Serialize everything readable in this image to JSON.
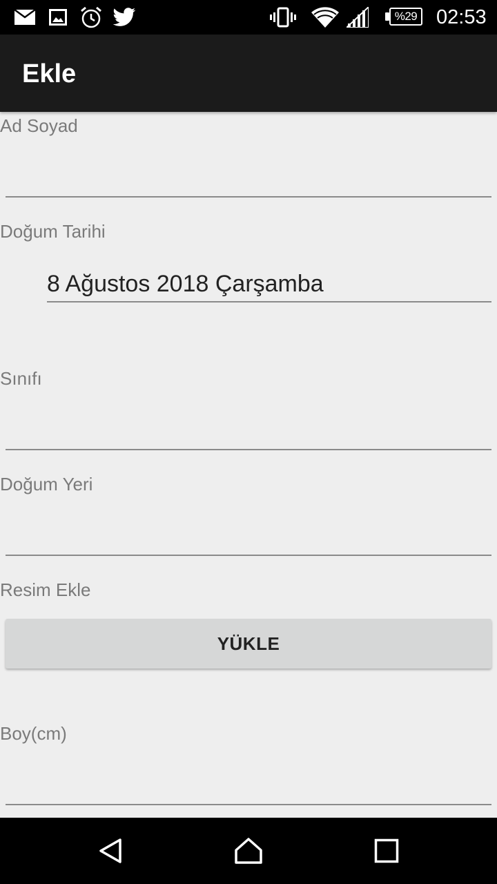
{
  "status_bar": {
    "icons": [
      "mail-icon",
      "image-icon",
      "alarm-icon",
      "twitter-icon",
      "vibrate-icon",
      "wifi-icon",
      "signal-icon",
      "battery-icon"
    ],
    "battery": "%29",
    "time": "02:53"
  },
  "app_bar": {
    "title": "Ekle"
  },
  "form": {
    "name_label": "Ad Soyad",
    "name_value": "",
    "birth_date_label": "Doğum Tarihi",
    "birth_date_value": "8 Ağustos 2018 Çarşamba",
    "class_label": "Sınıfı",
    "class_value": "",
    "birth_place_label": "Doğum Yeri",
    "birth_place_value": "",
    "image_label": "Resim Ekle",
    "upload_button": "YÜKLE",
    "height_label": "Boy(cm)",
    "height_value": ""
  },
  "nav_bar": {
    "icons": [
      "back-icon",
      "home-icon",
      "recents-icon"
    ]
  },
  "colors": {
    "status_bar": "#000000",
    "app_bar": "#1b1b1b",
    "background": "#eeeeee",
    "label": "#7a7a7a",
    "button": "#d6d7d7"
  }
}
